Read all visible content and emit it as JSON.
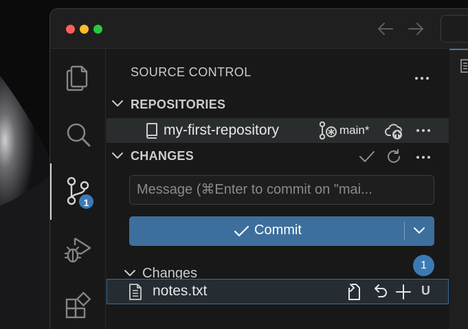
{
  "scm": {
    "title": "SOURCE CONTROL",
    "badge_count": "1",
    "repositories_header": "REPOSITORIES",
    "repository": {
      "name": "my-first-repository",
      "branch": "main*"
    },
    "changes_header": "CHANGES",
    "message_placeholder": "Message (⌘Enter to commit on \"mai...",
    "commit_label": "Commit",
    "changes_group": {
      "label": "Changes",
      "count": "1"
    },
    "files": [
      {
        "name": "notes.txt",
        "status": "U"
      }
    ]
  },
  "icons": {
    "activity_bar": [
      "files-icon",
      "search-icon",
      "source-control-icon",
      "run-debug-icon",
      "extensions-icon"
    ],
    "window_controls": [
      "close",
      "minimize",
      "maximize"
    ]
  },
  "colors": {
    "accent": "#3d6f9c",
    "badge": "#3d7ab3",
    "traffic_close": "#ff5f57",
    "traffic_min": "#febc2e",
    "traffic_max": "#28c840"
  }
}
